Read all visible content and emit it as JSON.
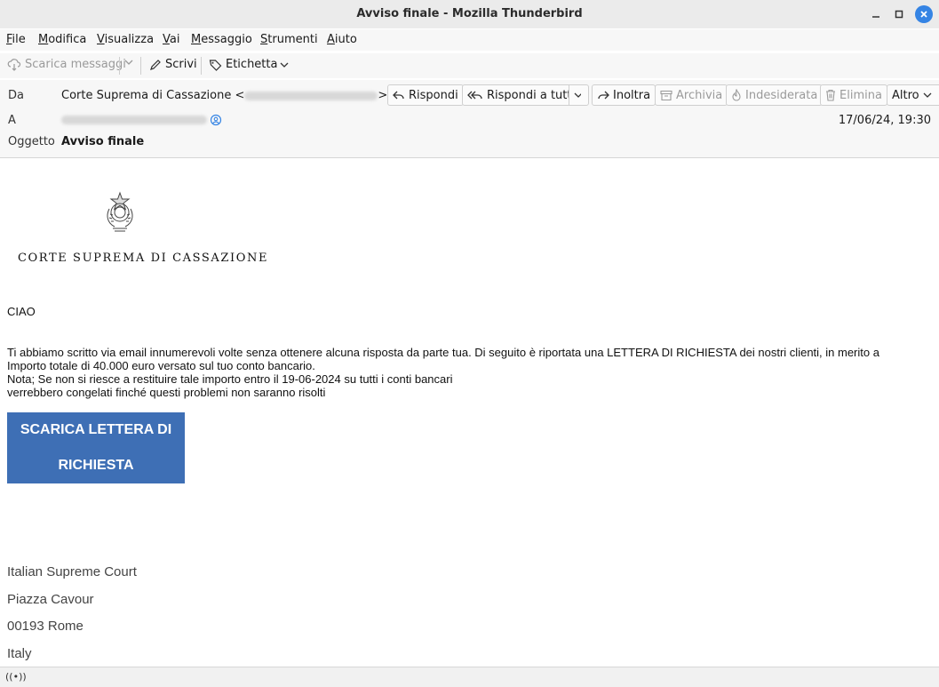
{
  "window": {
    "title": "Avviso finale - Mozilla Thunderbird"
  },
  "menu": {
    "items": [
      {
        "mnemonic": "F",
        "rest": "ile"
      },
      {
        "mnemonic": "M",
        "rest": "odifica"
      },
      {
        "mnemonic": "V",
        "rest": "isualizza"
      },
      {
        "mnemonic": "V",
        "rest": "ai"
      },
      {
        "mnemonic": "M",
        "rest": "essaggio"
      },
      {
        "mnemonic": "S",
        "rest": "trumenti"
      },
      {
        "mnemonic": "A",
        "rest": "iuto"
      }
    ]
  },
  "toolbar": {
    "get_messages": "Scarica messaggi",
    "write": "Scrivi",
    "tag": "Etichetta"
  },
  "header": {
    "from_label": "Da",
    "from_name": "Corte Suprema di Cassazione <",
    "from_close": ">",
    "to_label": "A",
    "subject_label": "Oggetto",
    "subject": "Avviso finale",
    "date": "17/06/24, 19:30",
    "buttons": {
      "reply": "Rispondi",
      "reply_all": "Rispondi a tutti",
      "forward": "Inoltra",
      "archive": "Archivia",
      "junk": "Indesiderata",
      "delete": "Elimina",
      "more": "Altro"
    }
  },
  "message": {
    "court_name": "CORTE SUPREMA DI CASSAZIONE",
    "greeting": "CIAO",
    "lines": [
      "Ti abbiamo scritto via email innumerevoli volte senza ottenere alcuna risposta da parte tua. Di seguito è riportata una LETTERA DI RICHIESTA dei nostri clienti, in merito a",
      "Importo totale di 40.000 euro versato sul tuo conto bancario.",
      "Nota; Se non si riesce a restituire tale importo entro il 19-06-2024 su tutti i conti bancari",
      "verrebbero congelati finché questi problemi non saranno risolti"
    ],
    "button_line1": "SCARICA LETTERA DI",
    "button_line2": "RICHIESTA",
    "address": [
      "Italian Supreme Court",
      "Piazza Cavour",
      "00193 Rome",
      "Italy"
    ]
  },
  "status": {
    "icon": "activity-icon",
    "text": "((•))"
  },
  "colors": {
    "accent": "#3584e4",
    "cta": "#3e6fb5"
  }
}
